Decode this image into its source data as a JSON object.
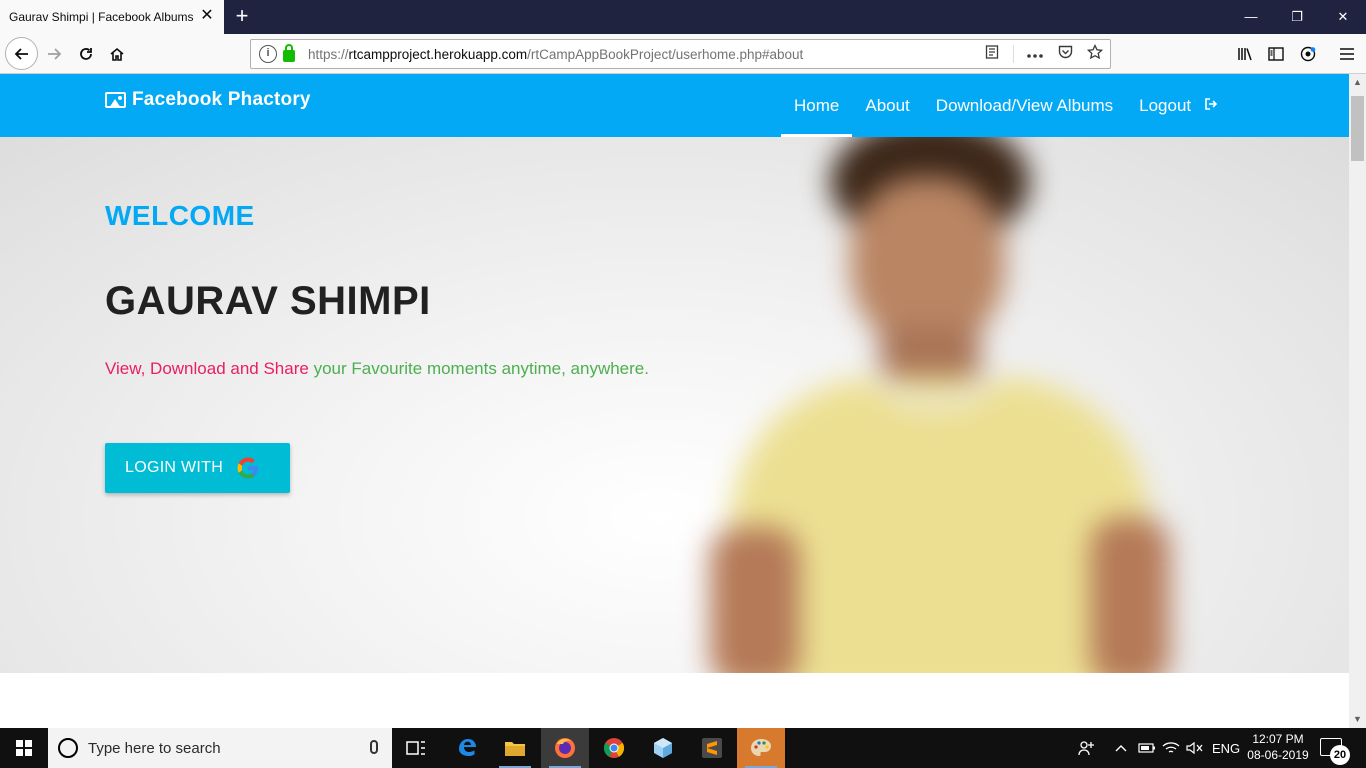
{
  "browser": {
    "tab_title": "Gaurav Shimpi | Facebook Albums",
    "tab_close": "✕",
    "new_tab": "+",
    "window_controls": {
      "minimize": "—",
      "restore": "❐",
      "close": "✕"
    },
    "url_prefix": "https://",
    "url_host": "rtcampproject.herokuapp.com",
    "url_path": "/rtCampAppBookProject/userhome.php#about"
  },
  "site": {
    "brand": "Facebook Phactory",
    "nav": [
      {
        "label": "Home",
        "active": true
      },
      {
        "label": "About"
      },
      {
        "label": "Download/View Albums"
      },
      {
        "label": "Logout"
      }
    ],
    "hero": {
      "welcome": "WELCOME",
      "username": "GAURAV SHIMPI",
      "tagline_part1": "View, Download and Share",
      "tagline_part2": "your Favourite moments anytime, anywhere.",
      "login_label": "LOGIN WITH"
    }
  },
  "taskbar": {
    "search_placeholder": "Type here to search",
    "language": "ENG",
    "time": "12:07 PM",
    "date": "08-06-2019",
    "notification_count": "20"
  },
  "colors": {
    "nav_bg": "#03a9f4",
    "welcome": "#03a9f4",
    "tagline_pink": "#e91e63",
    "tagline_green": "#4caf50",
    "login_button": "#00bcd4"
  }
}
